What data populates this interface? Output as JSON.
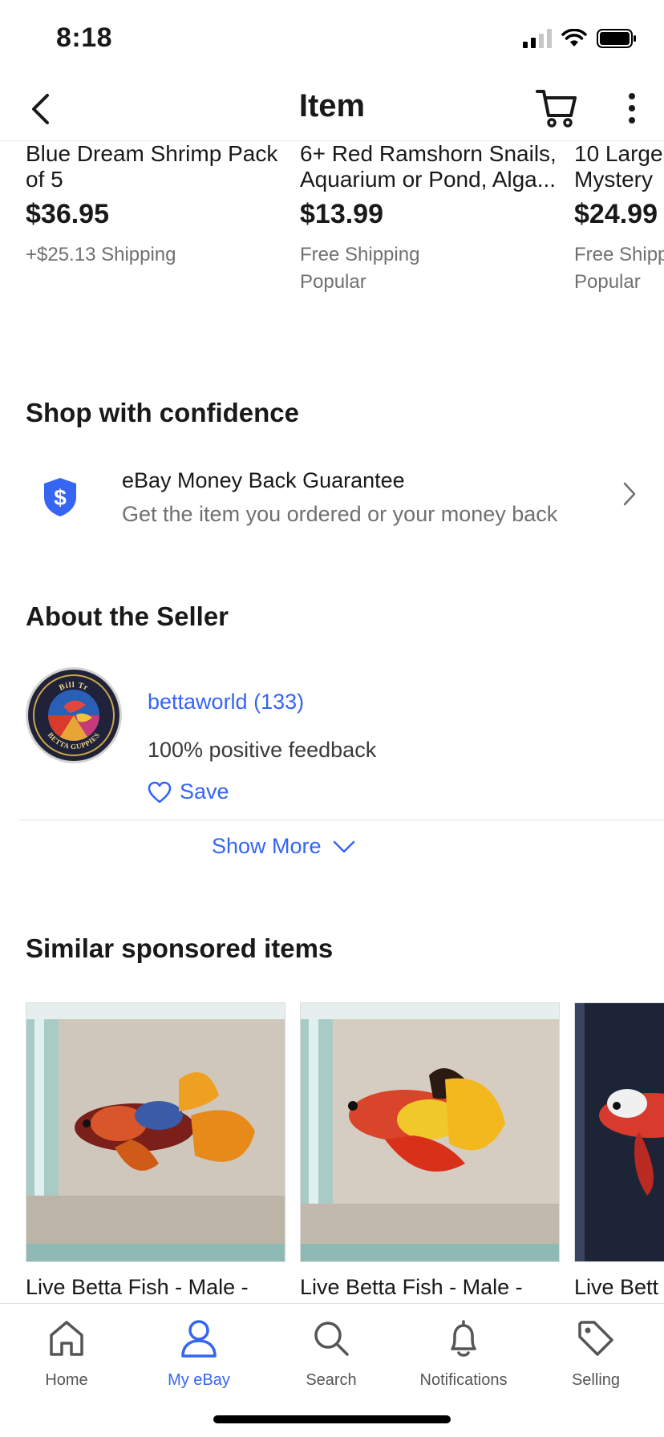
{
  "status_bar": {
    "time": "8:18"
  },
  "nav": {
    "title": "Item"
  },
  "top_items": [
    {
      "title_line1": "Blue Dream Shrimp Pack",
      "title_line2": "of 5",
      "price": "$36.95",
      "shipping": "+$25.13 Shipping",
      "badge": ""
    },
    {
      "title_line1": "6+ Red Ramshorn Snails,",
      "title_line2": "Aquarium or Pond, Alga...",
      "price": "$13.99",
      "shipping": "Free Shipping",
      "badge": "Popular"
    },
    {
      "title_line1": "10 Large",
      "title_line2": "Mystery",
      "price": "$24.99",
      "shipping": "Free Shipp",
      "badge": "Popular"
    }
  ],
  "confidence": {
    "heading": "Shop with confidence",
    "title": "eBay Money Back Guarantee",
    "subtitle": "Get the item you ordered or your money back"
  },
  "seller": {
    "heading": "About the Seller",
    "name": "bettaworld (133)",
    "feedback": "100% positive feedback",
    "save_label": "Save",
    "show_more": "Show More",
    "logo_top_text": "Bill Tr",
    "logo_bottom_text": "BETTA GUPPIES"
  },
  "sponsored": {
    "heading": "Similar sponsored items",
    "items": [
      {
        "title": "Live Betta Fish - Male -"
      },
      {
        "title": "Live Betta Fish - Male -"
      },
      {
        "title": "Live Bett"
      }
    ]
  },
  "tabs": [
    {
      "label": "Home",
      "icon": "home-icon"
    },
    {
      "label": "My eBay",
      "icon": "person-icon"
    },
    {
      "label": "Search",
      "icon": "search-icon"
    },
    {
      "label": "Notifications",
      "icon": "bell-icon"
    },
    {
      "label": "Selling",
      "icon": "tag-icon"
    }
  ],
  "colors": {
    "accent": "#3665f3",
    "text": "#191919",
    "muted": "#707070"
  }
}
